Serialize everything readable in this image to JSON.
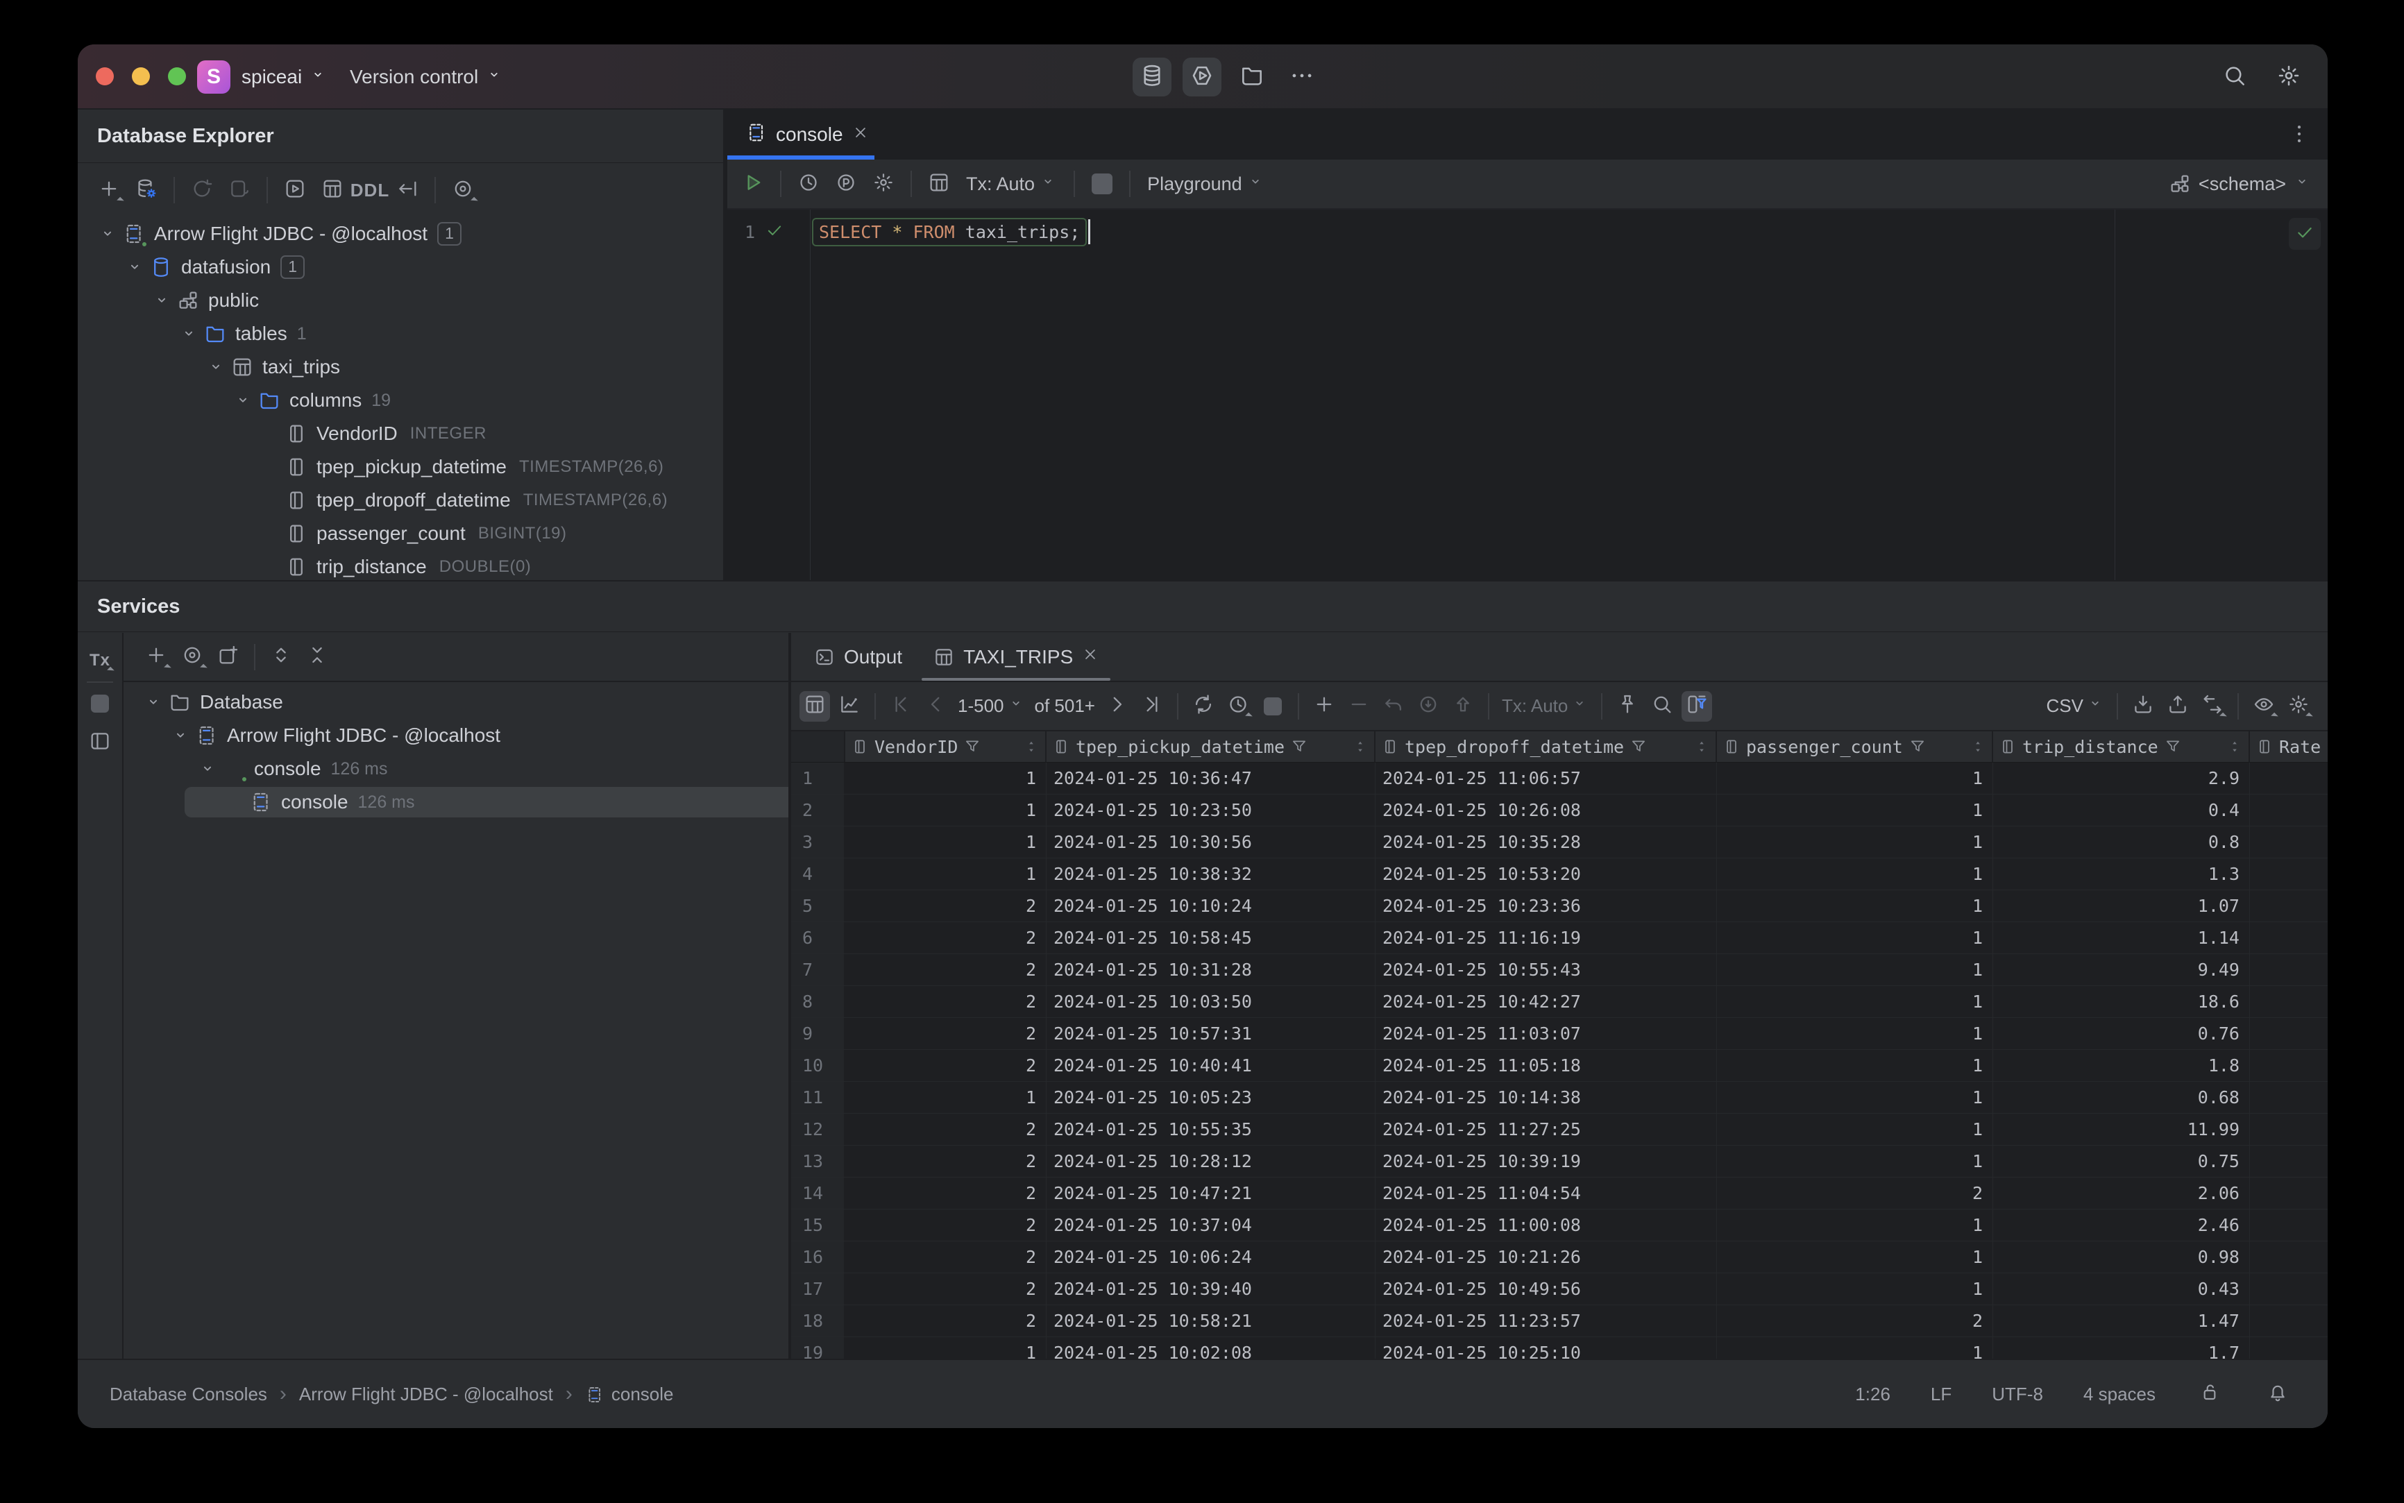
{
  "titlebar": {
    "app_initial": "S",
    "project": "spiceai",
    "menu_version_control": "Version control"
  },
  "icons": {
    "search-icon": "magnifier",
    "gear-icon": "cogwheel",
    "database-icon": "db cylinder",
    "hexagon-run-icon": "hexagon with play triangle",
    "folder-icon": "folder outline",
    "more-icon": "ellipsis",
    "bell-icon": "notification bell",
    "lock-open-icon": "unlocked padlock",
    "close-icon": "x cross",
    "chevron-down-icon": "v caret",
    "filter-icon": "funnel",
    "pin-icon": "push pin",
    "eye-icon": "eye",
    "clock-icon": "clock face"
  },
  "database_explorer": {
    "title": "Database Explorer",
    "ddl_label": "DDL",
    "tree": [
      {
        "label": "Arrow Flight JDBC - @localhost",
        "level": 0,
        "icon": "datasource",
        "chevron": true,
        "badge": "1",
        "green_dot": true
      },
      {
        "label": "datafusion",
        "level": 1,
        "icon": "database",
        "chevron": true,
        "badge": "1"
      },
      {
        "label": "public",
        "level": 2,
        "icon": "schema",
        "chevron": true
      },
      {
        "label": "tables",
        "level": 3,
        "icon": "folder",
        "chevron": true,
        "count": "1"
      },
      {
        "label": "taxi_trips",
        "level": 4,
        "icon": "table",
        "chevron": true
      },
      {
        "label": "columns",
        "level": 5,
        "icon": "folder",
        "chevron": true,
        "count": "19"
      },
      {
        "label": "VendorID",
        "level": 6,
        "icon": "column",
        "chevron": false,
        "type": "INTEGER"
      },
      {
        "label": "tpep_pickup_datetime",
        "level": 6,
        "icon": "column",
        "chevron": false,
        "type": "TIMESTAMP(26,6)"
      },
      {
        "label": "tpep_dropoff_datetime",
        "level": 6,
        "icon": "column",
        "chevron": false,
        "type": "TIMESTAMP(26,6)"
      },
      {
        "label": "passenger_count",
        "level": 6,
        "icon": "column",
        "chevron": false,
        "type": "BIGINT(19)"
      },
      {
        "label": "trip_distance",
        "level": 6,
        "icon": "column",
        "chevron": false,
        "type": "DOUBLE(0)"
      }
    ]
  },
  "editor": {
    "tab_label": "console",
    "line_number": "1",
    "toolbar": {
      "tx_label": "Tx: Auto",
      "playground_label": "Playground",
      "schema_label": "<schema>"
    },
    "sql_tokens": [
      {
        "text": "SELECT",
        "type": "kw"
      },
      {
        "text": " ",
        "type": "pl"
      },
      {
        "text": "*",
        "type": "star"
      },
      {
        "text": " ",
        "type": "pl"
      },
      {
        "text": "FROM",
        "type": "kw"
      },
      {
        "text": " taxi_trips",
        "type": "id"
      },
      {
        "text": ";",
        "type": "pl"
      }
    ]
  },
  "services": {
    "title": "Services",
    "rail_tx_label": "Tx",
    "tree": [
      {
        "label": "Database",
        "level": 0,
        "icon": "folder-plain",
        "chevron": true
      },
      {
        "label": "Arrow Flight JDBC - @localhost",
        "level": 1,
        "icon": "datasource",
        "chevron": true
      },
      {
        "label": "console",
        "level": 2,
        "icon": "console-run",
        "chevron": true,
        "time": "126 ms",
        "green_dot": true
      },
      {
        "label": "console",
        "level": 3,
        "icon": "datasource",
        "chevron": false,
        "time": "126 ms",
        "selected": true
      }
    ]
  },
  "results": {
    "tabs": {
      "output": "Output",
      "result": "TAXI_TRIPS"
    },
    "toolbar": {
      "range": "1-500",
      "of_total": "of 501+",
      "tx_label": "Tx: Auto",
      "format_label": "CSV"
    },
    "grid": {
      "columns": [
        {
          "name": "VendorID",
          "align": "right"
        },
        {
          "name": "tpep_pickup_datetime",
          "align": "left"
        },
        {
          "name": "tpep_dropoff_datetime",
          "align": "left"
        },
        {
          "name": "passenger_count",
          "align": "right"
        },
        {
          "name": "trip_distance",
          "align": "right"
        },
        {
          "name": "Rate",
          "align": "right",
          "clipped": true
        }
      ],
      "rows": [
        [
          "1",
          "1",
          "2024-01-25 10:36:47",
          "2024-01-25 11:06:57",
          "1",
          "2.9",
          ""
        ],
        [
          "2",
          "1",
          "2024-01-25 10:23:50",
          "2024-01-25 10:26:08",
          "1",
          "0.4",
          ""
        ],
        [
          "3",
          "1",
          "2024-01-25 10:30:56",
          "2024-01-25 10:35:28",
          "1",
          "0.8",
          ""
        ],
        [
          "4",
          "1",
          "2024-01-25 10:38:32",
          "2024-01-25 10:53:20",
          "1",
          "1.3",
          ""
        ],
        [
          "5",
          "2",
          "2024-01-25 10:10:24",
          "2024-01-25 10:23:36",
          "1",
          "1.07",
          ""
        ],
        [
          "6",
          "2",
          "2024-01-25 10:58:45",
          "2024-01-25 11:16:19",
          "1",
          "1.14",
          ""
        ],
        [
          "7",
          "2",
          "2024-01-25 10:31:28",
          "2024-01-25 10:55:43",
          "1",
          "9.49",
          ""
        ],
        [
          "8",
          "2",
          "2024-01-25 10:03:50",
          "2024-01-25 10:42:27",
          "1",
          "18.6",
          ""
        ],
        [
          "9",
          "2",
          "2024-01-25 10:57:31",
          "2024-01-25 11:03:07",
          "1",
          "0.76",
          ""
        ],
        [
          "10",
          "2",
          "2024-01-25 10:40:41",
          "2024-01-25 11:05:18",
          "1",
          "1.8",
          ""
        ],
        [
          "11",
          "1",
          "2024-01-25 10:05:23",
          "2024-01-25 10:14:38",
          "1",
          "0.68",
          ""
        ],
        [
          "12",
          "2",
          "2024-01-25 10:55:35",
          "2024-01-25 11:27:25",
          "1",
          "11.99",
          ""
        ],
        [
          "13",
          "2",
          "2024-01-25 10:28:12",
          "2024-01-25 10:39:19",
          "1",
          "0.75",
          ""
        ],
        [
          "14",
          "2",
          "2024-01-25 10:47:21",
          "2024-01-25 11:04:54",
          "2",
          "2.06",
          ""
        ],
        [
          "15",
          "2",
          "2024-01-25 10:37:04",
          "2024-01-25 11:00:08",
          "1",
          "2.46",
          ""
        ],
        [
          "16",
          "2",
          "2024-01-25 10:06:24",
          "2024-01-25 10:21:26",
          "1",
          "0.98",
          ""
        ],
        [
          "17",
          "2",
          "2024-01-25 10:39:40",
          "2024-01-25 10:49:56",
          "1",
          "0.43",
          ""
        ],
        [
          "18",
          "2",
          "2024-01-25 10:58:21",
          "2024-01-25 11:23:57",
          "2",
          "1.47",
          ""
        ],
        [
          "19",
          "1",
          "2024-01-25 10:02:08",
          "2024-01-25 10:25:10",
          "1",
          "1.7",
          ""
        ]
      ]
    }
  },
  "statusbar": {
    "breadcrumbs": [
      "Database Consoles",
      "Arrow Flight JDBC - @localhost",
      "console"
    ],
    "caret_position": "1:26",
    "line_separator": "LF",
    "encoding": "UTF-8",
    "indent": "4 spaces"
  }
}
